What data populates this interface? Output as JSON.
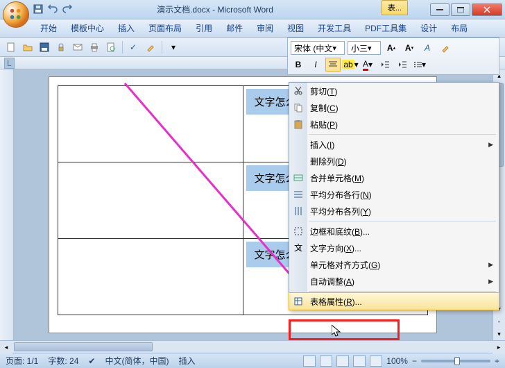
{
  "window": {
    "title": "演示文档.docx - Microsoft Word",
    "tool_tab": "表..."
  },
  "tabs": [
    "开始",
    "模板中心",
    "插入",
    "页面布局",
    "引用",
    "邮件",
    "审阅",
    "视图",
    "开发工具",
    "PDF工具集",
    "设计",
    "布局"
  ],
  "format_toolbar": {
    "font": "宋体 (中文",
    "size": "小三"
  },
  "table_cells": {
    "r1c2": "文字怎么放正中",
    "r2c2": "文字怎么上下居",
    "r3c2": "文字怎么放正中"
  },
  "context_menu": [
    {
      "icon": "cut",
      "label": "剪切(T)",
      "key": "T"
    },
    {
      "icon": "copy",
      "label": "复制(C)",
      "key": "C"
    },
    {
      "icon": "paste",
      "label": "粘贴(P)",
      "key": "P"
    },
    {
      "sep": true
    },
    {
      "label": "插入(I)",
      "submenu": true,
      "key": "I"
    },
    {
      "label": "删除列(D)",
      "key": "D"
    },
    {
      "icon": "merge",
      "label": "合并单元格(M)",
      "key": "M"
    },
    {
      "icon": "distrow",
      "label": "平均分布各行(N)",
      "key": "N"
    },
    {
      "icon": "distcol",
      "label": "平均分布各列(Y)",
      "key": "Y"
    },
    {
      "sep": true
    },
    {
      "icon": "borders",
      "label": "边框和底纹(B)...",
      "key": "B"
    },
    {
      "icon": "textdir",
      "label": "文字方向(X)...",
      "key": "X"
    },
    {
      "label": "单元格对齐方式(G)",
      "submenu": true,
      "key": "G"
    },
    {
      "label": "自动调整(A)",
      "submenu": true,
      "key": "A"
    },
    {
      "sep": true
    },
    {
      "icon": "props",
      "label": "表格属性(R)...",
      "key": "R",
      "highlight": true
    }
  ],
  "status": {
    "page": "页面: 1/1",
    "words": "字数: 24",
    "lang": "中文(简体，中国)",
    "mode": "插入",
    "zoom": "100%"
  },
  "ruler_right": "42"
}
